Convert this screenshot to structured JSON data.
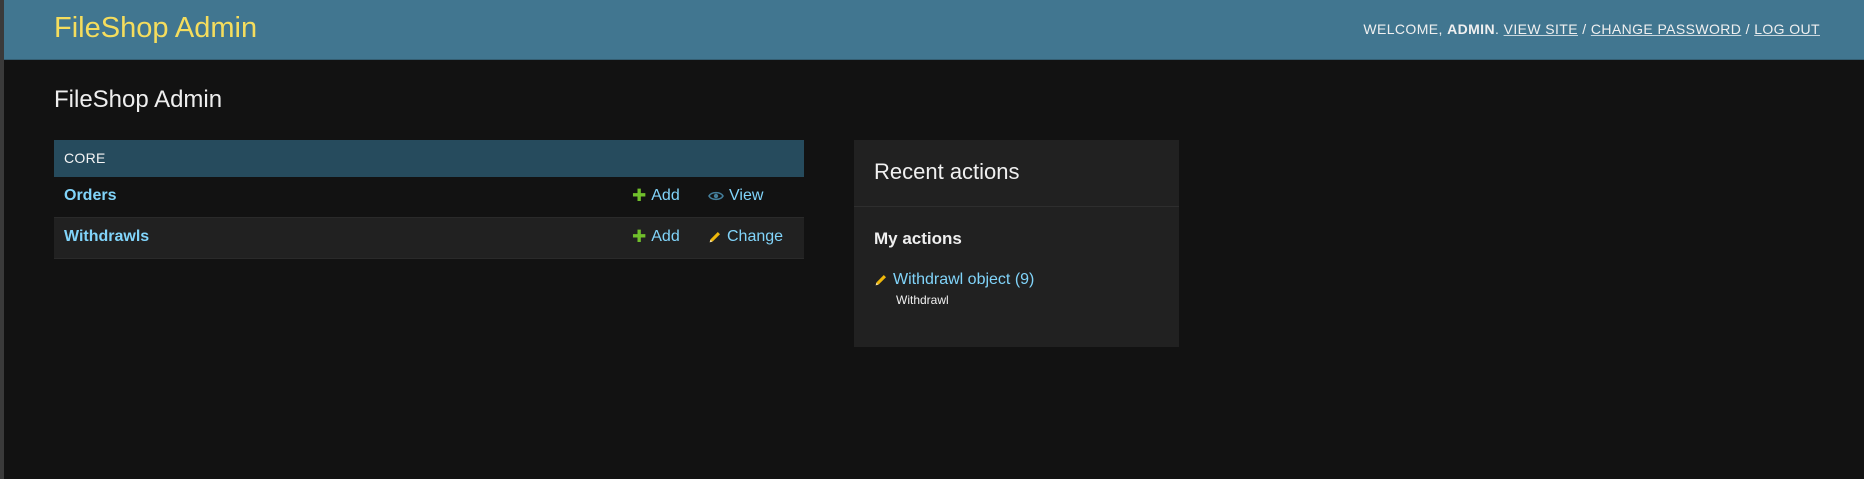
{
  "header": {
    "brand": "FileShop Admin",
    "welcome": "Welcome,",
    "username": "admin",
    "view_site": "View site",
    "change_password": "Change password",
    "log_out": "Log out",
    "separator": "/"
  },
  "page": {
    "title": "FileShop Admin"
  },
  "app_module": {
    "caption": "Core",
    "models": [
      {
        "name": "Orders",
        "add_label": "Add",
        "action_label": "View",
        "action_icon": "eye-icon"
      },
      {
        "name": "Withdrawls",
        "add_label": "Add",
        "action_label": "Change",
        "action_icon": "pencil-icon"
      }
    ]
  },
  "recent_actions": {
    "title": "Recent actions",
    "subtitle": "My actions",
    "items": [
      {
        "label": "Withdrawl object (9)",
        "type": "Withdrawl",
        "icon": "pencil-icon"
      }
    ]
  },
  "colors": {
    "header_bg": "#417690",
    "brand": "#f5dd5d",
    "caption_bg": "#264b5d",
    "link": "#81d4fa",
    "add_green": "#70bf2b",
    "change_yellow": "#efb80b",
    "view_blue": "#447e9b",
    "page_bg": "#121212"
  }
}
